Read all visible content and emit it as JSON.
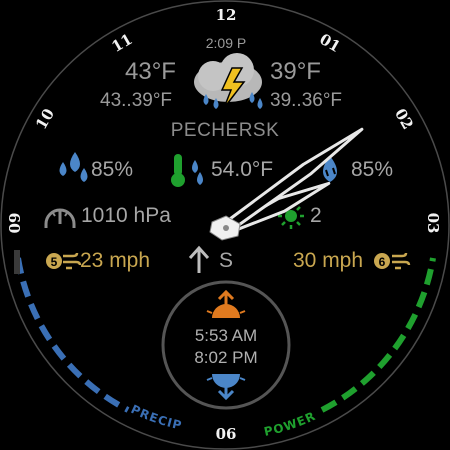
{
  "hour_markers": [
    "12",
    "01",
    "02",
    "03",
    "06",
    "09",
    "10",
    "11"
  ],
  "time": "2:09 P",
  "weather": {
    "current_temp": "43°F",
    "current_range": "43..39°F",
    "forecast_temp": "39°F",
    "forecast_range": "39..36°F",
    "condition_icon": "thunderstorm-icon",
    "location": "PECHERSK"
  },
  "stats": {
    "precip_chance": "85%",
    "feels_like": "54.0°F",
    "humidity": "85%",
    "pressure": "1010 hPa",
    "uv_index": "2",
    "wind_speed": "23 mph",
    "wind_beaufort": "5",
    "wind_direction": "S",
    "gust_speed": "30 mph",
    "gust_beaufort": "6"
  },
  "sun": {
    "sunrise": "5:53 AM",
    "sunset": "8:02 PM"
  },
  "arc_labels": {
    "precip": "PRECIP",
    "power": "POWER"
  },
  "arcs": {
    "precip_level": 0.9,
    "power_level": 1.0
  },
  "hands": {
    "hour": 2,
    "minute": 9
  },
  "colors": {
    "precip_arc": "#3a6fb5",
    "power_arc": "#1fa02e",
    "accent_orange": "#e07a1f",
    "gold_text": "#c9a750",
    "weather_blue": "#4b86c8"
  }
}
